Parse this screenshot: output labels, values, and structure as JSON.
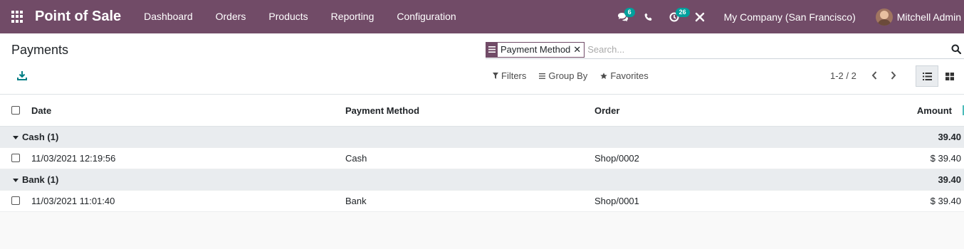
{
  "navbar": {
    "app_title": "Point of Sale",
    "menu": [
      "Dashboard",
      "Orders",
      "Products",
      "Reporting",
      "Configuration"
    ],
    "messages_badge": "6",
    "activities_badge": "26",
    "company": "My Company (San Francisco)",
    "user_name": "Mitchell Admin"
  },
  "control_panel": {
    "title": "Payments",
    "search_facet": "Payment Method",
    "search_placeholder": "Search...",
    "filters_label": "Filters",
    "group_by_label": "Group By",
    "favorites_label": "Favorites",
    "pager": "1-2 / 2"
  },
  "list": {
    "columns": {
      "date": "Date",
      "payment_method": "Payment Method",
      "order": "Order",
      "amount": "Amount"
    },
    "groups": [
      {
        "label": "Cash (1)",
        "total": "39.40",
        "records": [
          {
            "date": "11/03/2021 12:19:56",
            "payment_method": "Cash",
            "order": "Shop/0002",
            "amount": "$ 39.40"
          }
        ]
      },
      {
        "label": "Bank (1)",
        "total": "39.40",
        "records": [
          {
            "date": "11/03/2021 11:01:40",
            "payment_method": "Bank",
            "order": "Shop/0001",
            "amount": "$ 39.40"
          }
        ]
      }
    ]
  },
  "colors": {
    "brand": "#714B67",
    "badge": "#00A09D",
    "download_icon": "#017E84"
  }
}
